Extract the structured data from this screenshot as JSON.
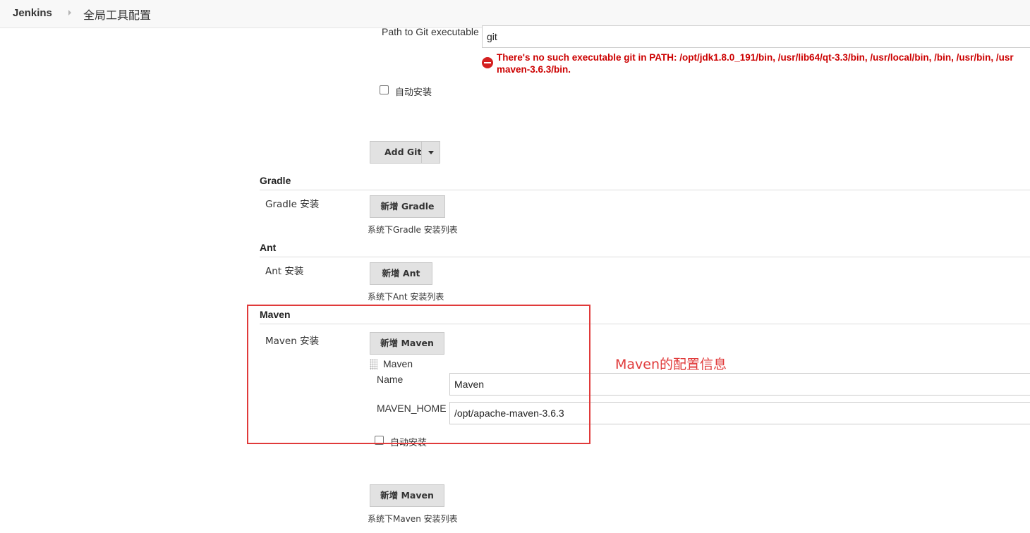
{
  "breadcrumb": {
    "root": "Jenkins",
    "page": "全局工具配置"
  },
  "git": {
    "path_label": "Path to Git executable",
    "path_value": "git",
    "error_line1": "There's no such executable git in PATH: /opt/jdk1.8.0_191/bin, /usr/lib64/qt-3.3/bin, /usr/local/bin, /bin, /usr/bin, /usr",
    "error_line2": "maven-3.6.3/bin.",
    "auto_install_label": "自动安装",
    "add_button": "Add Git"
  },
  "gradle": {
    "title": "Gradle",
    "install_label": "Gradle 安装",
    "add_button": "新增 Gradle",
    "description": "系统下Gradle 安装列表"
  },
  "ant": {
    "title": "Ant",
    "install_label": "Ant 安装",
    "add_button": "新增 Ant",
    "description": "系统下Ant 安装列表"
  },
  "maven": {
    "title": "Maven",
    "install_label": "Maven 安装",
    "add_button_top": "新增 Maven",
    "item_title": "Maven",
    "name_label": "Name",
    "name_value": "Maven",
    "home_label": "MAVEN_HOME",
    "home_value": "/opt/apache-maven-3.6.3",
    "auto_install_label": "自动安装",
    "add_button_bottom": "新增 Maven",
    "description": "系统下Maven 安装列表"
  },
  "annotation": {
    "text": "Maven的配置信息",
    "color": "#e03a3a"
  },
  "colors": {
    "error": "#cc0000",
    "button_bg": "#e2e2e2",
    "highlight": "#e03a3a"
  },
  "icons": {
    "error": "error-circle-icon",
    "dropdown": "caret-down-icon",
    "drag": "drag-handle-icon",
    "breadcrumb_separator": "chevron-right-icon"
  }
}
